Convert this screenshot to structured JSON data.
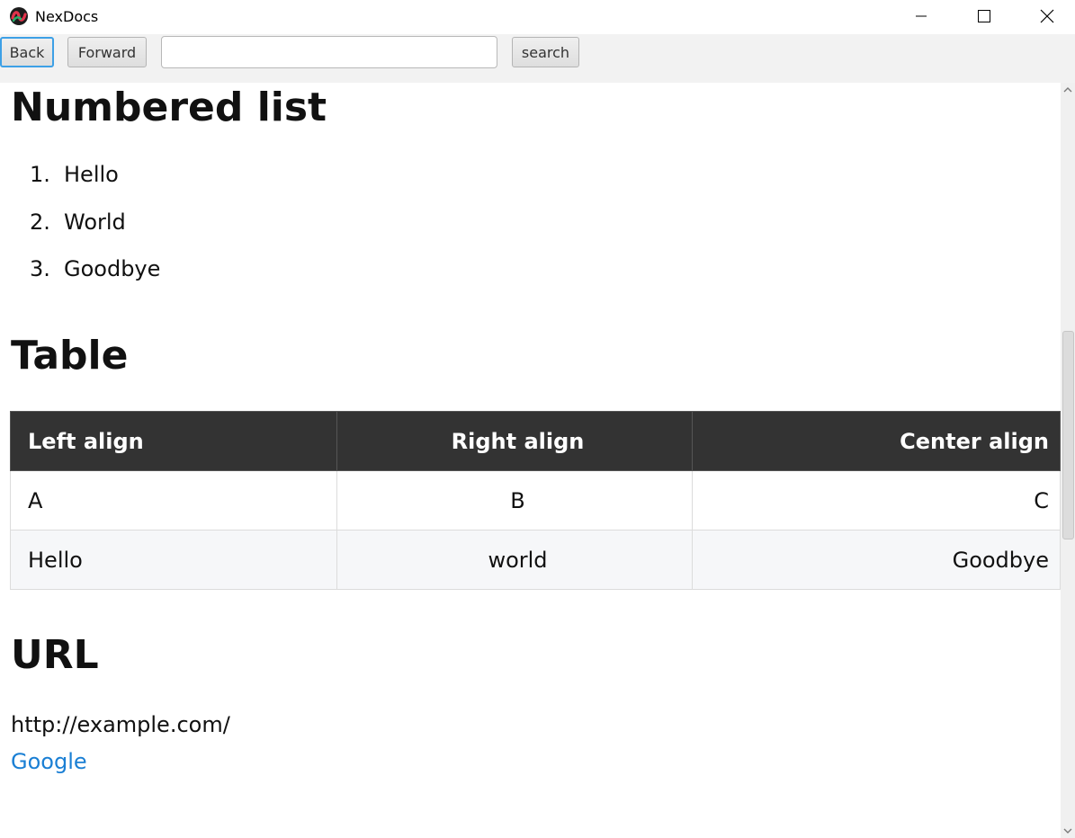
{
  "window": {
    "title": "NexDocs",
    "icon": "nexdocs-logo-icon",
    "controls": [
      "minimize-icon",
      "maximize-icon",
      "close-icon"
    ]
  },
  "toolbar": {
    "back_label": "Back",
    "forward_label": "Forward",
    "search_value": "",
    "search_label": "search"
  },
  "content": {
    "numbered_heading": "Numbered list",
    "numbered_items": [
      {
        "num": "1.",
        "text": "Hello"
      },
      {
        "num": "2.",
        "text": "World"
      },
      {
        "num": "3.",
        "text": "Goodbye"
      }
    ],
    "table_heading": "Table",
    "table": {
      "headers": [
        "Left align",
        "Right align",
        "Center align"
      ],
      "rows": [
        [
          "A",
          "B",
          "C"
        ],
        [
          "Hello",
          "world",
          "Goodbye"
        ]
      ]
    },
    "url_heading": "URL",
    "url_text": "http://example.com/",
    "link_text": "Google"
  },
  "colors": {
    "table_header_bg": "#333333",
    "link": "#1a7fd4",
    "focus_border": "#3da0e6"
  }
}
